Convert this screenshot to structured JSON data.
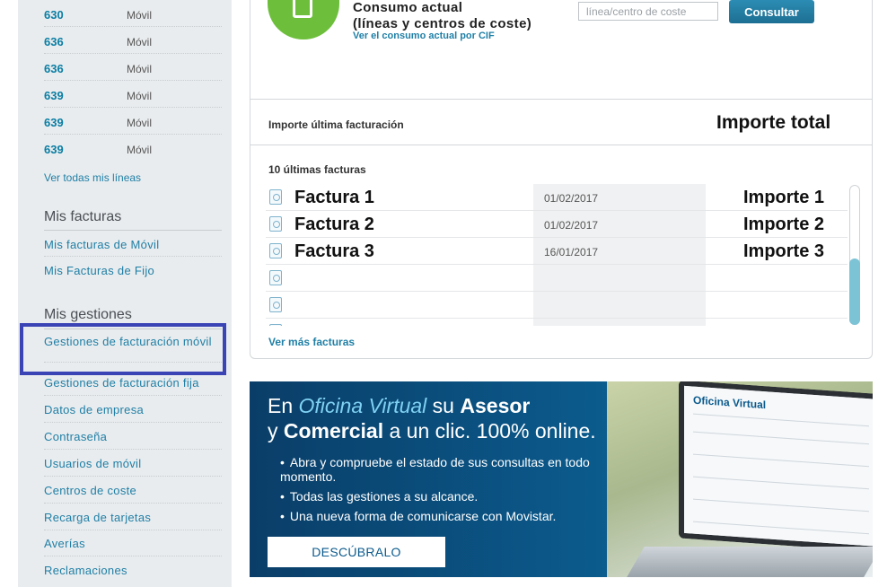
{
  "sidebar": {
    "lines": [
      {
        "num": "630",
        "type": "Móvil"
      },
      {
        "num": "636",
        "type": "Móvil"
      },
      {
        "num": "636",
        "type": "Móvil"
      },
      {
        "num": "639",
        "type": "Móvil"
      },
      {
        "num": "639",
        "type": "Móvil"
      },
      {
        "num": "639",
        "type": "Móvil"
      }
    ],
    "ver_todas": "Ver todas mis líneas",
    "facturas_title": "Mis facturas",
    "facturas_items": [
      "Mis facturas de Móvil",
      "Mis Facturas de Fijo"
    ],
    "gestiones_title": "Mis gestiones",
    "gestiones_items": [
      "Gestiones de facturación móvil",
      "Gestiones de facturación fija",
      "Datos de empresa",
      "Contraseña",
      "Usuarios de móvil",
      "Centros de coste",
      "Recarga de tarjetas",
      "Averías",
      "Reclamaciones"
    ]
  },
  "consumo": {
    "title_line1": "Consumo actual",
    "title_line2": "(líneas y centros de coste)",
    "link": "Ver el consumo actual por CIF",
    "search_placeholder": "línea/centro de coste",
    "button": "Consultar"
  },
  "importe": {
    "label": "Importe última facturación",
    "total": "Importe total"
  },
  "facturas": {
    "label": "10 últimas facturas",
    "rows": [
      {
        "name": "Factura 1",
        "date": "01/02/2017",
        "amount": "Importe 1"
      },
      {
        "name": "Factura 2",
        "date": "01/02/2017",
        "amount": "Importe 2"
      },
      {
        "name": "Factura 3",
        "date": "16/01/2017",
        "amount": "Importe 3"
      },
      {
        "name": "",
        "date": "",
        "amount": ""
      },
      {
        "name": "",
        "date": "",
        "amount": ""
      },
      {
        "name": "",
        "date": "",
        "amount": ""
      }
    ],
    "ver_mas": "Ver más facturas"
  },
  "banner": {
    "l1_a": "En ",
    "l1_oficina": "Oficina Virtual",
    "l1_b": " su ",
    "l1_asesor": "Asesor",
    "l2_a": "y ",
    "l2_comercial": "Comercial",
    "l2_b": " a un clic. 100% online.",
    "bullets": [
      "Abra y compruebe el estado de sus consultas en todo momento.",
      "Todas las gestiones a su alcance.",
      "Una nueva forma de comunicarse con Movistar."
    ],
    "button": "DESCÚBRALO",
    "laptop_title": "Oficina Virtual"
  },
  "colors": {
    "accent": "#1f7fa6",
    "green": "#6dbf3b",
    "highlight": "#3a44b5"
  }
}
